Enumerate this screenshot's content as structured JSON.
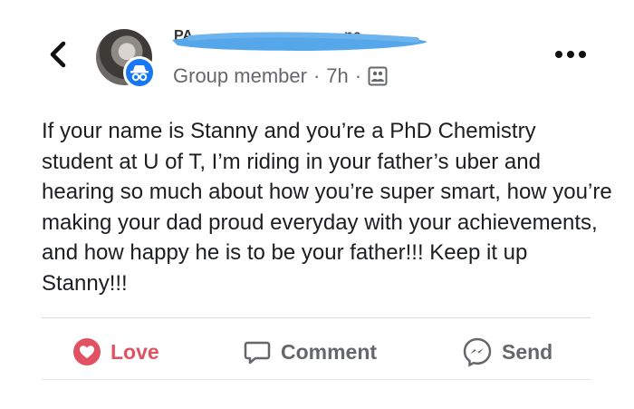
{
  "header": {
    "back_icon": "chevron-left-icon",
    "avatar_icon": "profile-photo",
    "badge_icon": "anonymous-incognito-icon",
    "author_name_visible": "PA... ne",
    "meta": {
      "role": "Group member",
      "separator": "·",
      "time": "7h",
      "audience_icon": "group-members-icon"
    },
    "more_icon": "more-dots-icon"
  },
  "post": {
    "text": "If your name is Stanny and you’re a PhD Chemistry student at U of T, I’m riding in your father’s uber and hearing so much about how you’re super smart, how you’re making your dad proud everyday with your achievements, and how happy he is to be your father!!! Keep it up Stanny!!!"
  },
  "actions": {
    "love": {
      "label": "Love",
      "icon": "heart-icon",
      "color": "#e05261"
    },
    "comment": {
      "label": "Comment",
      "icon": "comment-bubble-icon"
    },
    "send": {
      "label": "Send",
      "icon": "messenger-icon"
    }
  },
  "colors": {
    "accent": "#1877f2",
    "redaction": "#56a6ea",
    "muted_text": "#65676b"
  }
}
